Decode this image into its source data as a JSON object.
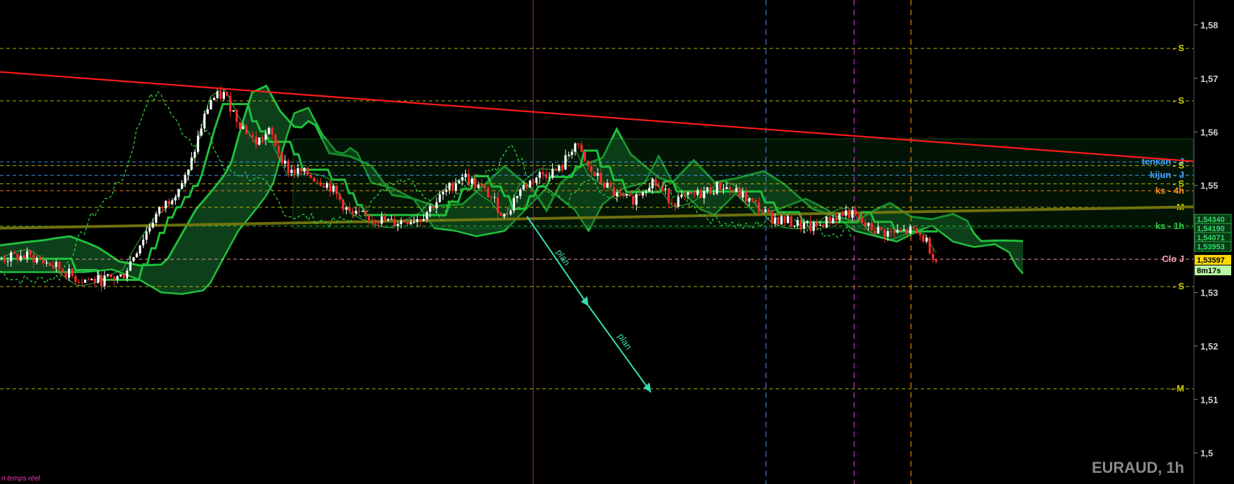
{
  "chart_data": {
    "type": "candlestick",
    "symbol_label": "EURAUD, 1h",
    "realtime_label": "n temps réel",
    "y_axis": {
      "ticks": [
        "1,58",
        "1,57",
        "1,56",
        "1,55",
        "1,54",
        "1,53",
        "1,52",
        "1,51",
        "1,5"
      ],
      "tick_values": [
        1.58,
        1.57,
        1.56,
        1.55,
        1.54,
        1.53,
        1.52,
        1.51,
        1.5
      ],
      "range": [
        1.4965,
        1.5835
      ]
    },
    "levels": [
      {
        "label": "- S",
        "value": 1.5756,
        "color": "#c8c800",
        "style": "dash"
      },
      {
        "label": "- S",
        "value": 1.5658,
        "color": "#c8c800",
        "style": "dash"
      },
      {
        "label": "tenkan - J",
        "value": 1.5544,
        "color": "#4aa3ff",
        "style": "dash"
      },
      {
        "label": "- S",
        "value": 1.5537,
        "color": "#c8c800",
        "style": "dash"
      },
      {
        "label": "kijun - J",
        "value": 1.5519,
        "color": "#4aa3ff",
        "style": "dash"
      },
      {
        "label": "- S",
        "value": 1.5503,
        "color": "#c8c800",
        "style": "dash"
      },
      {
        "label": "ks - 4h",
        "value": 1.549,
        "color": "#ff8c1a",
        "style": "dash"
      },
      {
        "label": "- M",
        "value": 1.5459,
        "color": "#c8c800",
        "style": "dash"
      },
      {
        "label": "ks - 1h",
        "value": 1.5424,
        "color": "#2ecc40",
        "style": "dash"
      },
      {
        "label": "Clo J",
        "value": 1.5362,
        "color": "#ff9fb0",
        "style": "dash"
      },
      {
        "label": "- S",
        "value": 1.5311,
        "color": "#c8c800",
        "style": "dash"
      },
      {
        "label": "- M",
        "value": 1.512,
        "color": "#c8c800",
        "style": "dash"
      }
    ],
    "price_badges": [
      {
        "text": "1,54340",
        "value": 1.5434,
        "bg": "#0b3a1a",
        "fg": "#33dd66"
      },
      {
        "text": "1,54190",
        "value": 1.5419,
        "bg": "#0b3a1a",
        "fg": "#33dd66"
      },
      {
        "text": "1,54071",
        "value": 1.5407,
        "bg": "#0b3a1a",
        "fg": "#33dd66"
      },
      {
        "text": "1,53953",
        "value": 1.5395,
        "bg": "#0b3a1a",
        "fg": "#33dd66"
      },
      {
        "text": "1,53597",
        "value": 1.53597,
        "bg": "#ffd800",
        "fg": "#000000"
      },
      {
        "text": "8m17s",
        "value": 1.5345,
        "bg": "#b9f7a0",
        "fg": "#000000"
      }
    ],
    "annotations": [
      {
        "text": "plan"
      },
      {
        "text": "plan"
      }
    ],
    "colors": {
      "up": "#ffffff",
      "down": "#ff2a2a",
      "trendline": "#ff1a1a",
      "cloud": "#0f4a1f",
      "cloud_line": "#1fbf3c",
      "ma": "#7a7a10",
      "vline_blue": "#3a7bd5",
      "vline_magenta": "#cc33cc",
      "vline_orange": "#e08a00",
      "arrow": "#33e0b0"
    }
  }
}
